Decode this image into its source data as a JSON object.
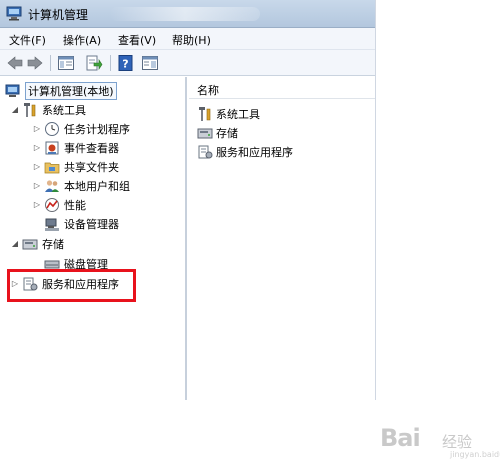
{
  "window": {
    "title": "计算机管理"
  },
  "menu": [
    "文件(F)",
    "操作(A)",
    "查看(V)",
    "帮助(H)"
  ],
  "toolbar": [
    {
      "name": "back-arrow-icon"
    },
    {
      "name": "forward-arrow-icon"
    },
    {
      "name": "show-hide-console-tree-icon"
    },
    {
      "name": "export-list-icon"
    },
    {
      "name": "help-icon"
    },
    {
      "name": "show-action-pane-icon"
    }
  ],
  "tree": {
    "root": "计算机管理(本地)",
    "system_tools": "系统工具",
    "task_scheduler": "任务计划程序",
    "event_viewer": "事件查看器",
    "shared_folders": "共享文件夹",
    "local_users": "本地用户和组",
    "performance": "性能",
    "device_manager": "设备管理器",
    "storage": "存储",
    "disk_management": "磁盘管理",
    "services_apps": "服务和应用程序"
  },
  "list": {
    "header": "名称",
    "items": [
      "系统工具",
      "存储",
      "服务和应用程序"
    ]
  },
  "watermark": {
    "brand": "Bai",
    "sub": "经验",
    "url": "jingyan.baidu.com"
  },
  "colors": {
    "highlight": "#e8121c",
    "titlebar": "#b3c7de"
  }
}
